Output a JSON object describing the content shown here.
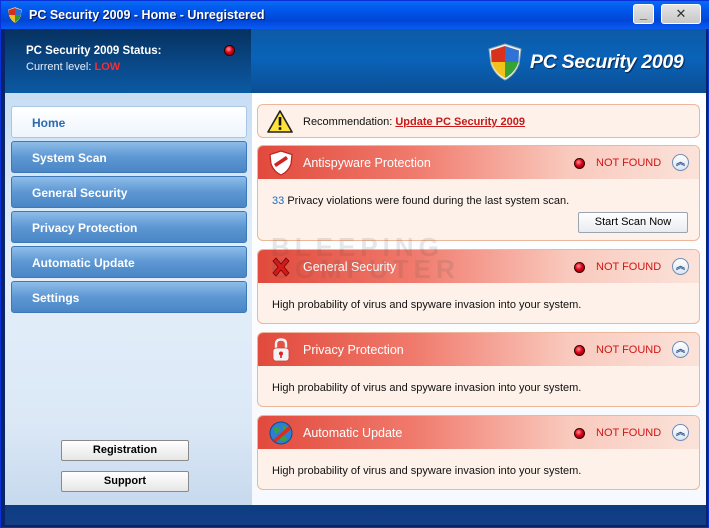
{
  "window": {
    "title": "PC Security 2009 - Home - Unregistered",
    "minimize_glyph": "_",
    "close_glyph": "✕"
  },
  "header": {
    "status_title": "PC Security 2009 Status:",
    "current_level_label": "Current level:",
    "current_level_value": "LOW",
    "brand_name": "PC Security 2009"
  },
  "sidebar": {
    "items": [
      {
        "label": "Home",
        "active": true
      },
      {
        "label": "System Scan",
        "active": false
      },
      {
        "label": "General Security",
        "active": false
      },
      {
        "label": "Privacy Protection",
        "active": false
      },
      {
        "label": "Automatic Update",
        "active": false
      },
      {
        "label": "Settings",
        "active": false
      }
    ],
    "registration_button": "Registration",
    "support_button": "Support"
  },
  "recommendation": {
    "label": "Recommendation:",
    "link_text": "Update PC Security 2009"
  },
  "panels": [
    {
      "title": "Antispyware Protection",
      "status": "NOT FOUND",
      "icon": "shield-alert-icon",
      "count": "33",
      "message": "Privacy violations were found during the last system scan.",
      "button": "Start Scan Now"
    },
    {
      "title": "General Security",
      "status": "NOT FOUND",
      "icon": "red-x-icon",
      "message": "High probability of virus and spyware invasion into your system."
    },
    {
      "title": "Privacy Protection",
      "status": "NOT FOUND",
      "icon": "padlock-icon",
      "message": "High probability of virus and spyware invasion into your system."
    },
    {
      "title": "Automatic Update",
      "status": "NOT FOUND",
      "icon": "globe-update-icon",
      "message": "High probability of virus and spyware invasion into your system."
    }
  ],
  "watermark": {
    "line1": "BLEEPING",
    "line2": "COMPUTER"
  },
  "colors": {
    "accent_red": "#d11616",
    "brand_blue": "#0a63b9",
    "panel_header_red": "#e14a3c"
  }
}
